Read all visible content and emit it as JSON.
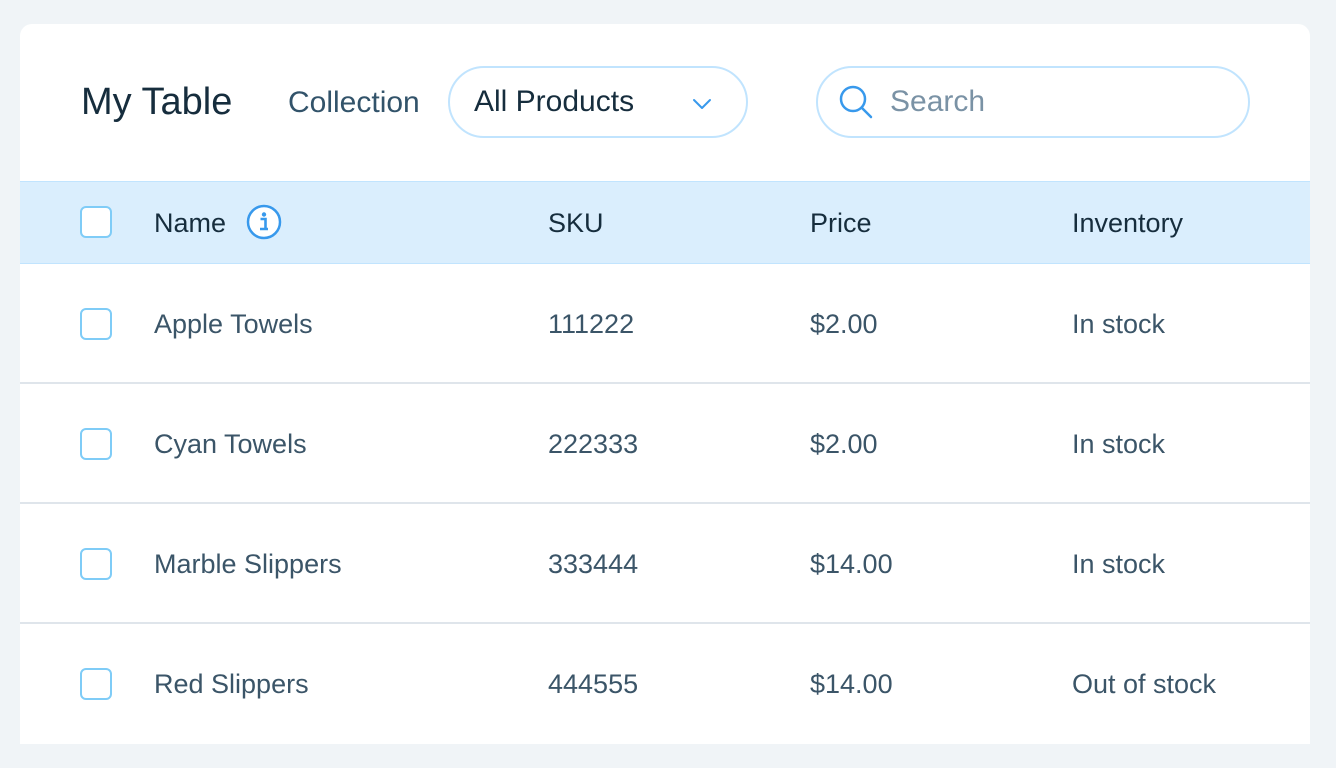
{
  "header": {
    "title": "My Table",
    "collection_label": "Collection",
    "collection_value": "All Products",
    "search_placeholder": "Search"
  },
  "columns": {
    "name": "Name",
    "sku": "SKU",
    "price": "Price",
    "inventory": "Inventory"
  },
  "rows": [
    {
      "name": "Apple Towels",
      "sku": "111222",
      "price": "$2.00",
      "inventory": "In stock"
    },
    {
      "name": "Cyan Towels",
      "sku": "222333",
      "price": "$2.00",
      "inventory": "In stock"
    },
    {
      "name": "Marble Slippers",
      "sku": "333444",
      "price": "$14.00",
      "inventory": "In stock"
    },
    {
      "name": "Red Slippers",
      "sku": "444555",
      "price": "$14.00",
      "inventory": "Out of stock"
    }
  ],
  "icons": {
    "dropdown": "chevron-down-icon",
    "search": "search-icon",
    "info": "info-icon"
  },
  "colors": {
    "accent": "#3899EC",
    "header_bg": "#DAEEFD",
    "border": "#C1E4FE",
    "text": "#162D3D"
  }
}
